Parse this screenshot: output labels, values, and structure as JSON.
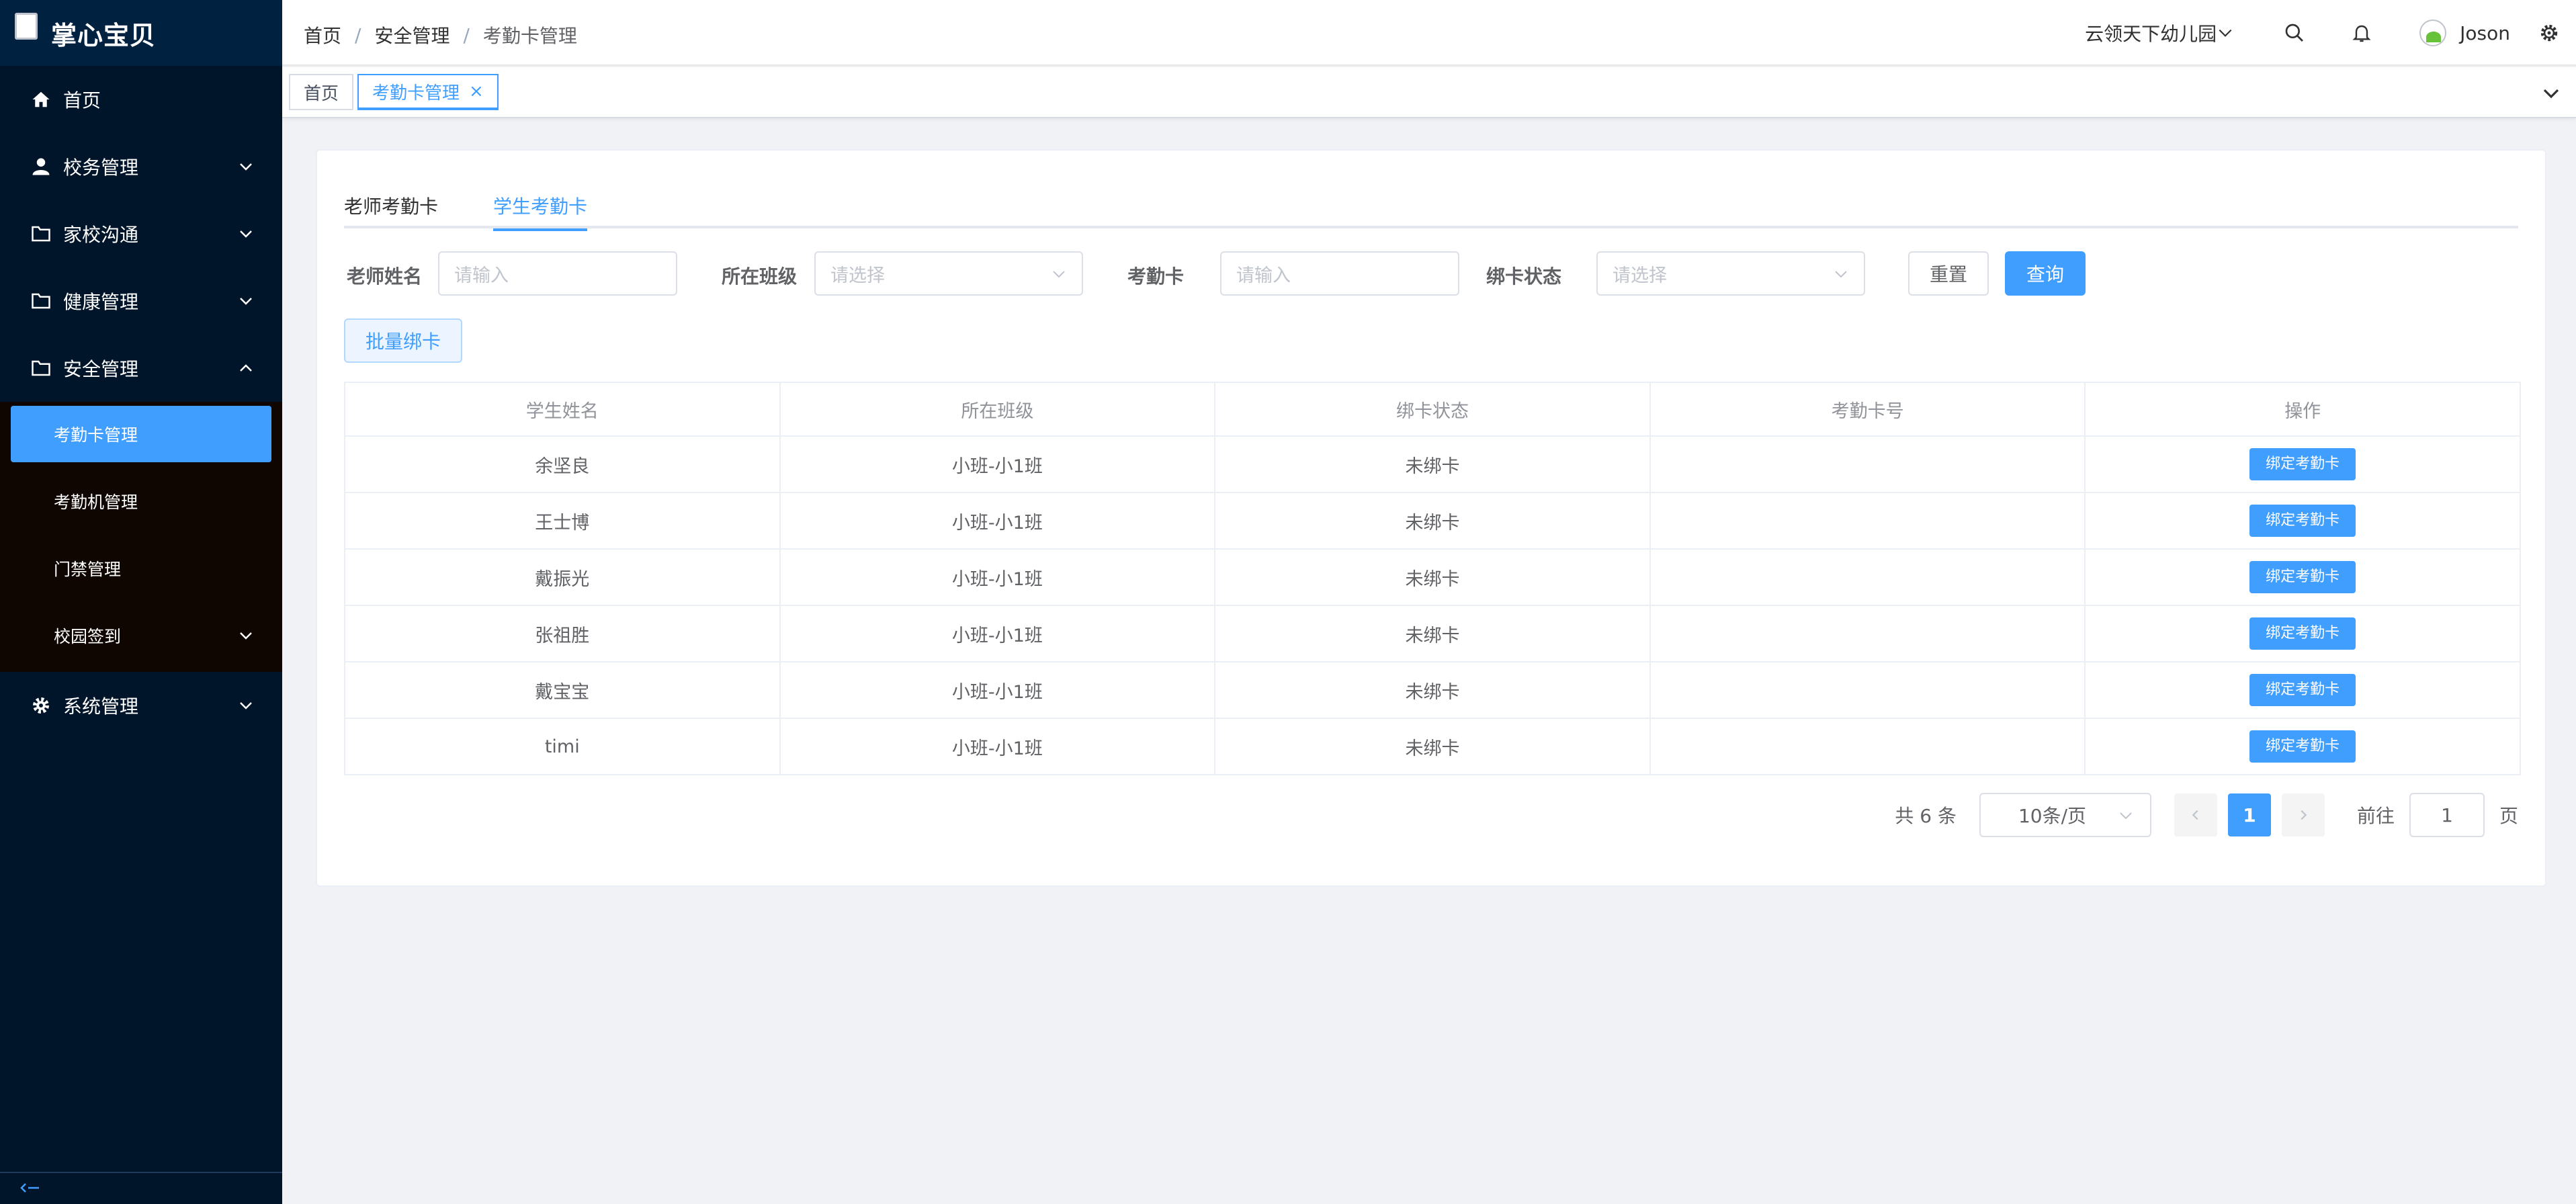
{
  "app": {
    "logo_text": "掌心宝贝"
  },
  "sidebar": {
    "items": [
      {
        "label": "首页"
      },
      {
        "label": "校务管理"
      },
      {
        "label": "家校沟通"
      },
      {
        "label": "健康管理"
      },
      {
        "label": "安全管理"
      },
      {
        "label": "系统管理"
      }
    ],
    "security_sub": [
      {
        "label": "考勤卡管理"
      },
      {
        "label": "考勤机管理"
      },
      {
        "label": "门禁管理"
      },
      {
        "label": "校园签到"
      }
    ]
  },
  "header": {
    "breadcrumb": [
      "首页",
      "安全管理",
      "考勤卡管理"
    ],
    "breadcrumb_sep": "/",
    "school": "云领天下幼儿园",
    "username": "Joson"
  },
  "tags": [
    {
      "label": "首页"
    },
    {
      "label": "考勤卡管理",
      "close": "×"
    }
  ],
  "tabs": [
    {
      "label": "老师考勤卡"
    },
    {
      "label": "学生考勤卡"
    }
  ],
  "filters": {
    "teacher_label": "老师姓名",
    "teacher_placeholder": "请输入",
    "class_label": "所在班级",
    "class_placeholder": "请选择",
    "card_label": "考勤卡",
    "card_placeholder": "请输入",
    "status_label": "绑卡状态",
    "status_placeholder": "请选择",
    "reset": "重置",
    "query": "查询",
    "batch_bind": "批量绑卡"
  },
  "table": {
    "headers": [
      "学生姓名",
      "所在班级",
      "绑卡状态",
      "考勤卡号",
      "操作"
    ],
    "action_label": "绑定考勤卡",
    "rows": [
      {
        "name": "余坚良",
        "class": "小班-小1班",
        "status": "未绑卡",
        "card": ""
      },
      {
        "name": "王士博",
        "class": "小班-小1班",
        "status": "未绑卡",
        "card": ""
      },
      {
        "name": "戴振光",
        "class": "小班-小1班",
        "status": "未绑卡",
        "card": ""
      },
      {
        "name": "张祖胜",
        "class": "小班-小1班",
        "status": "未绑卡",
        "card": ""
      },
      {
        "name": "戴宝宝",
        "class": "小班-小1班",
        "status": "未绑卡",
        "card": ""
      },
      {
        "name": "timi",
        "class": "小班-小1班",
        "status": "未绑卡",
        "card": ""
      }
    ]
  },
  "pagination": {
    "total_text": "共 6 条",
    "page_size": "10条/页",
    "current_page": "1",
    "goto_label": "前往",
    "goto_value": "1",
    "page_suffix": "页"
  },
  "colors": {
    "primary": "#409eff",
    "sidebar_bg": "#001529",
    "submenu_bg": "#0f0602"
  }
}
